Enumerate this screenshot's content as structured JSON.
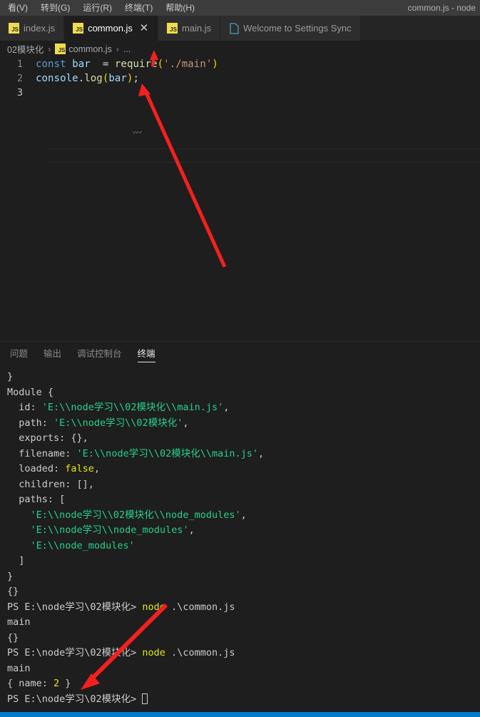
{
  "window": {
    "title": "common.js - node",
    "menu_items": [
      {
        "label": "看(V)"
      },
      {
        "label": "转到(G)"
      },
      {
        "label": "运行(R)"
      },
      {
        "label": "终端(T)"
      },
      {
        "label": "帮助(H)"
      }
    ]
  },
  "tabs": [
    {
      "label": "index.js",
      "icon": "js-file-icon",
      "active": false,
      "closable": false
    },
    {
      "label": "common.js",
      "icon": "js-file-icon",
      "active": true,
      "closable": true,
      "close_label": "✕"
    },
    {
      "label": "main.js",
      "icon": "js-file-icon",
      "active": false,
      "closable": false
    },
    {
      "label": "Welcome to Settings Sync",
      "icon": "blue-file-icon",
      "active": false,
      "closable": false
    }
  ],
  "breadcrumb": {
    "folder": "02模块化",
    "file": "common.js",
    "symbol": "...",
    "separator": "›"
  },
  "editor": {
    "lines": [
      {
        "number": "1",
        "tokens": [
          {
            "t": "const",
            "c": "k-kw"
          },
          {
            "t": " ",
            "c": "k-op"
          },
          {
            "t": "bar",
            "c": "k-var"
          },
          {
            "t": "  = ",
            "c": "k-op"
          },
          {
            "t": "require",
            "c": "k-fn"
          },
          {
            "t": "(",
            "c": "k-paren"
          },
          {
            "t": "'./main'",
            "c": "k-str"
          },
          {
            "t": ")",
            "c": "k-paren"
          }
        ]
      },
      {
        "number": "2",
        "tokens": [
          {
            "t": "console",
            "c": "k-obj"
          },
          {
            "t": ".",
            "c": "k-op"
          },
          {
            "t": "log",
            "c": "k-prop"
          },
          {
            "t": "(",
            "c": "k-paren"
          },
          {
            "t": "bar",
            "c": "k-var"
          },
          {
            "t": ")",
            "c": "k-paren"
          },
          {
            "t": ";",
            "c": "k-op"
          }
        ]
      },
      {
        "number": "3",
        "tokens": []
      }
    ]
  },
  "panel": {
    "tabs": [
      {
        "label": "问题",
        "active": false
      },
      {
        "label": "输出",
        "active": false
      },
      {
        "label": "调试控制台",
        "active": false
      },
      {
        "label": "终端",
        "active": true
      }
    ],
    "terminal_lines": [
      [
        {
          "t": "}",
          "c": "t-white"
        }
      ],
      [
        {
          "t": "Module {",
          "c": "t-white"
        }
      ],
      [
        {
          "t": "  id: ",
          "c": "t-white"
        },
        {
          "t": "'E:\\\\node学习\\\\02模块化\\\\main.js'",
          "c": "t-green"
        },
        {
          "t": ",",
          "c": "t-white"
        }
      ],
      [
        {
          "t": "  path: ",
          "c": "t-white"
        },
        {
          "t": "'E:\\\\node学习\\\\02模块化'",
          "c": "t-green"
        },
        {
          "t": ",",
          "c": "t-white"
        }
      ],
      [
        {
          "t": "  exports: {},",
          "c": "t-white"
        }
      ],
      [
        {
          "t": "  filename: ",
          "c": "t-white"
        },
        {
          "t": "'E:\\\\node学习\\\\02模块化\\\\main.js'",
          "c": "t-green"
        },
        {
          "t": ",",
          "c": "t-white"
        }
      ],
      [
        {
          "t": "  loaded: ",
          "c": "t-white"
        },
        {
          "t": "false",
          "c": "t-yellow"
        },
        {
          "t": ",",
          "c": "t-white"
        }
      ],
      [
        {
          "t": "  children: [],",
          "c": "t-white"
        }
      ],
      [
        {
          "t": "  paths: [",
          "c": "t-white"
        }
      ],
      [
        {
          "t": "    ",
          "c": "t-white"
        },
        {
          "t": "'E:\\\\node学习\\\\02模块化\\\\node_modules'",
          "c": "t-green"
        },
        {
          "t": ",",
          "c": "t-white"
        }
      ],
      [
        {
          "t": "    ",
          "c": "t-white"
        },
        {
          "t": "'E:\\\\node学习\\\\node_modules'",
          "c": "t-green"
        },
        {
          "t": ",",
          "c": "t-white"
        }
      ],
      [
        {
          "t": "    ",
          "c": "t-white"
        },
        {
          "t": "'E:\\\\node_modules'",
          "c": "t-green"
        }
      ],
      [
        {
          "t": "  ]",
          "c": "t-white"
        }
      ],
      [
        {
          "t": "}",
          "c": "t-white"
        }
      ],
      [
        {
          "t": "{}",
          "c": "t-white"
        }
      ],
      [
        {
          "t": "PS E:\\node学习\\02模块化> ",
          "c": "t-white"
        },
        {
          "t": "node",
          "c": "t-yellow"
        },
        {
          "t": " .\\common.js",
          "c": "t-white"
        }
      ],
      [
        {
          "t": "main",
          "c": "t-white"
        }
      ],
      [
        {
          "t": "{}",
          "c": "t-white"
        }
      ],
      [
        {
          "t": "PS E:\\node学习\\02模块化> ",
          "c": "t-white"
        },
        {
          "t": "node",
          "c": "t-yellow"
        },
        {
          "t": " .\\common.js",
          "c": "t-white"
        }
      ],
      [
        {
          "t": "main",
          "c": "t-white"
        }
      ],
      [
        {
          "t": "{ name: ",
          "c": "t-white"
        },
        {
          "t": "2",
          "c": "t-yellow"
        },
        {
          "t": " }",
          "c": "t-white"
        }
      ],
      [
        {
          "t": "PS E:\\node学习\\02模块化> ",
          "c": "t-white"
        },
        {
          "t": "█",
          "c": "t-cursorbox"
        }
      ]
    ]
  },
  "annotations": {
    "color": "#f42020",
    "arrows": [
      {
        "name": "arrow-to-breadcrumb-symbol"
      },
      {
        "name": "arrow-to-bar-variable"
      },
      {
        "name": "arrow-to-name-output"
      }
    ]
  },
  "statusbar": {
    "color": "#007acc"
  }
}
